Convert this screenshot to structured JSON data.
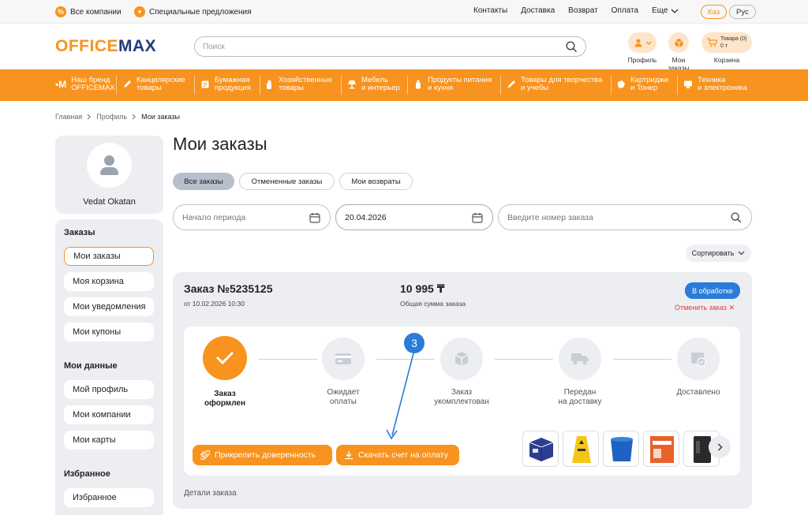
{
  "topbar": {
    "all_companies": "Все компании",
    "special_offers": "Специальные предложения",
    "nav": [
      "Контакты",
      "Доставка",
      "Возврат",
      "Оплата",
      "Еще"
    ],
    "lang_kz": "Каз",
    "lang_ru": "Рус"
  },
  "header": {
    "logo_part1": "OFFICE",
    "logo_part2": "MAX",
    "search_placeholder": "Поиск",
    "profile_label": "Профиль",
    "orders_label": "Мои заказы",
    "cart_label": "Корзина",
    "cart_count": "Товара (0)",
    "cart_sum": "0 т"
  },
  "categories": [
    {
      "l1": "Наш бренд",
      "l2": "OFFICEMAX"
    },
    {
      "l1": "Канцелярские",
      "l2": "товары"
    },
    {
      "l1": "Бумажная",
      "l2": "продукция"
    },
    {
      "l1": "Хозяйственные",
      "l2": "товары"
    },
    {
      "l1": "Мебель",
      "l2": "и интерьер"
    },
    {
      "l1": "Продукты питания",
      "l2": "и кухня"
    },
    {
      "l1": "Товары для творчества",
      "l2": "и учебы"
    },
    {
      "l1": "Картриджи",
      "l2": "и Тонер"
    },
    {
      "l1": "Техника",
      "l2": "и электроника"
    }
  ],
  "breadcrumb": [
    "Главная",
    "Профиль",
    "Мои заказы"
  ],
  "sidebar": {
    "user_name": "Vedat Okatan",
    "orders_heading": "Заказы",
    "orders_items": [
      "Мои заказы",
      "Моя корзина",
      "Мои уведомления",
      "Мои купоны"
    ],
    "data_heading": "Мои данные",
    "data_items": [
      "Мой профиль",
      "Мои компании",
      "Мои карты"
    ],
    "fav_heading": "Избранное",
    "fav_items": [
      "Избранное"
    ]
  },
  "main": {
    "title": "Мои заказы",
    "tabs": [
      "Все заказы",
      "Отмененные заказы",
      "Мои возвраты"
    ],
    "period_placeholder": "Начало периода",
    "date_value": "20.04.2026",
    "order_search_placeholder": "Введите номер заказа",
    "sort_label": "Сортировать"
  },
  "order": {
    "title": "Заказ №5235125",
    "date": "от 10.02.2026  10:30",
    "sum": "10 995 ₸",
    "sum_label": "Общая сумма заказа",
    "status": "В обработке",
    "cancel": "Отменить заказ",
    "steps": [
      {
        "l1": "Заказ",
        "l2": "оформлен"
      },
      {
        "l1": "Ожидает",
        "l2": "оплаты"
      },
      {
        "l1": "Заказ",
        "l2": "укомплектован"
      },
      {
        "l1": "Передан",
        "l2": "на доставку"
      },
      {
        "l1": "Доставлено",
        "l2": ""
      }
    ],
    "attach_button": "Прикрепить доверенность",
    "download_button": "Скачать счет на оплату",
    "details": "Детали заказа"
  },
  "annotation": {
    "number": "3",
    "color": "#2b7bd8"
  },
  "colors": {
    "accent": "#f7931e",
    "brand_blue": "#1f3b7a",
    "status_blue": "#2b7bd8",
    "danger": "#e53935"
  }
}
